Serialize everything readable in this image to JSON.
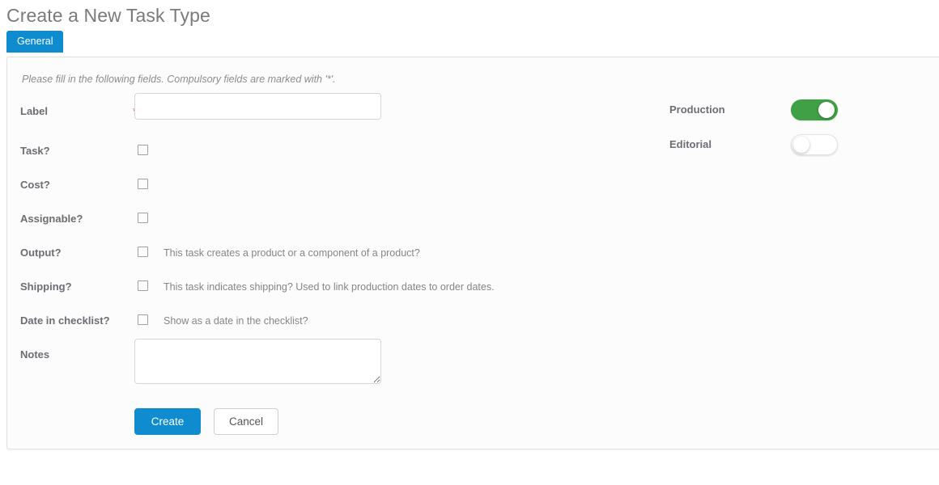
{
  "page_title": "Create a New Task Type",
  "tabs": [
    {
      "label": "General",
      "active": true
    }
  ],
  "form": {
    "hint": "Please fill in the following fields. Compulsory fields are marked with '*'.",
    "required_marker": "*",
    "fields": [
      {
        "label": "Label",
        "type": "text",
        "value": "",
        "placeholder": "",
        "required": true,
        "description": ""
      },
      {
        "label": "Task?",
        "type": "checkbox",
        "checked": false,
        "description": ""
      },
      {
        "label": "Cost?",
        "type": "checkbox",
        "checked": false,
        "description": ""
      },
      {
        "label": "Assignable?",
        "type": "checkbox",
        "checked": false,
        "description": ""
      },
      {
        "label": "Output?",
        "type": "checkbox",
        "checked": false,
        "description": "This task creates a product or a component of a product?"
      },
      {
        "label": "Shipping?",
        "type": "checkbox",
        "checked": false,
        "description": "This task indicates shipping? Used to link production dates to order dates."
      },
      {
        "label": "Date in checklist?",
        "type": "checkbox",
        "checked": false,
        "description": "Show as a date in the checklist?"
      },
      {
        "label": "Notes",
        "type": "textarea",
        "value": "",
        "placeholder": "",
        "description": ""
      }
    ],
    "toggles": [
      {
        "label": "Production",
        "on": true
      },
      {
        "label": "Editorial",
        "on": false
      }
    ],
    "actions": {
      "submit_label": "Create",
      "cancel_label": "Cancel"
    }
  },
  "colors": {
    "accent_blue": "#0e8ccf",
    "toggle_on_green": "#3fa045",
    "required_red": "#d9534f",
    "label_gray": "#6d6d73",
    "panel_bg": "#fcfcfc"
  }
}
